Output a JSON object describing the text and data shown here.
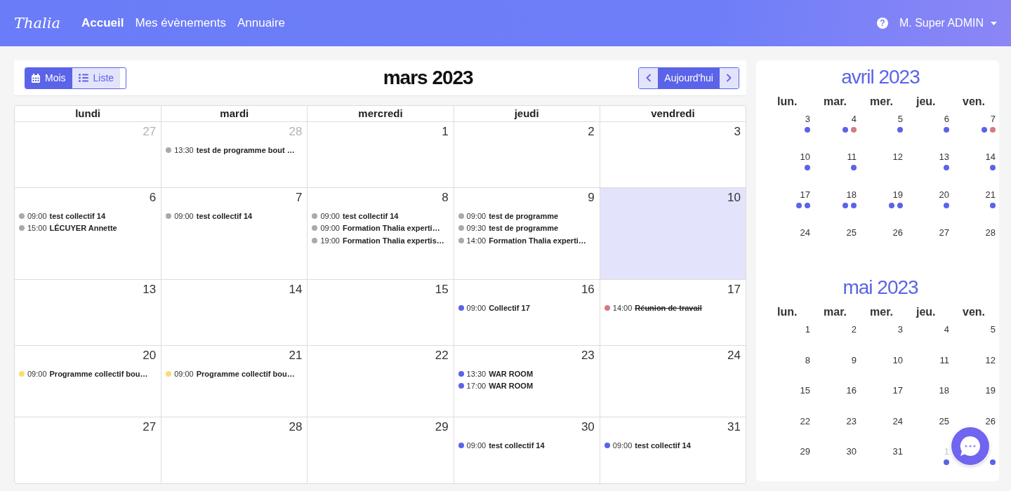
{
  "nav": {
    "logo": "Thalia",
    "links": [
      {
        "label": "Accueil",
        "selected": true
      },
      {
        "label": "Mes évènements",
        "selected": false
      },
      {
        "label": "Annuaire",
        "selected": false
      }
    ],
    "help": "?",
    "user": "M. Super ADMIN"
  },
  "calendar": {
    "views": [
      {
        "label": "Mois",
        "selected": true,
        "kind": "month"
      },
      {
        "label": "Liste",
        "selected": false,
        "kind": "list"
      }
    ],
    "title": "mars 2023",
    "today_button": "Aujourd'hui",
    "weekdays": [
      "lundi",
      "mardi",
      "mercredi",
      "jeudi",
      "vendredi"
    ],
    "weeks": [
      [
        {
          "day": "27",
          "other_month": true,
          "today": false
        },
        {
          "day": "28",
          "other_month": true,
          "today": false,
          "events": [
            {
              "time": "13:30",
              "title": "test de programme bout …",
              "color": "#aaaaaa",
              "cancelled": false
            }
          ]
        },
        {
          "day": "1",
          "today": false
        },
        {
          "day": "2",
          "today": false
        },
        {
          "day": "3",
          "today": false
        }
      ],
      [
        {
          "day": "6",
          "today": false,
          "events": [
            {
              "time": "09:00",
              "title": "test collectif 14",
              "color": "#aaaaaa",
              "cancelled": false
            },
            {
              "time": "15:00",
              "title": "LÉCUYER Annette",
              "color": "#aaaaaa",
              "cancelled": false
            }
          ]
        },
        {
          "day": "7",
          "today": false,
          "events": [
            {
              "time": "09:00",
              "title": "test collectif 14",
              "color": "#aaaaaa",
              "cancelled": false
            }
          ]
        },
        {
          "day": "8",
          "today": false,
          "events": [
            {
              "time": "09:00",
              "title": "test collectif 14",
              "color": "#aaaaaa",
              "cancelled": false
            },
            {
              "time": "09:00",
              "title": "Formation Thalia experti…",
              "color": "#aaaaaa",
              "cancelled": false
            },
            {
              "time": "19:00",
              "title": "Formation Thalia expertis…",
              "color": "#aaaaaa",
              "cancelled": false
            }
          ]
        },
        {
          "day": "9",
          "today": false,
          "events": [
            {
              "time": "09:00",
              "title": "test de programme",
              "color": "#aaaaaa",
              "cancelled": false
            },
            {
              "time": "09:30",
              "title": "test de programme",
              "color": "#aaaaaa",
              "cancelled": false
            },
            {
              "time": "14:00",
              "title": "Formation Thalia experti…",
              "color": "#aaaaaa",
              "cancelled": false
            }
          ]
        },
        {
          "day": "10",
          "today": true
        }
      ],
      [
        {
          "day": "13",
          "today": false
        },
        {
          "day": "14",
          "today": false
        },
        {
          "day": "15",
          "today": false
        },
        {
          "day": "16",
          "today": false,
          "events": [
            {
              "time": "09:00",
              "title": "Collectif 17",
              "color": "#5b63e8",
              "cancelled": false
            }
          ]
        },
        {
          "day": "17",
          "today": false,
          "events": [
            {
              "time": "14:00",
              "title": "Réunion de travail",
              "color": "#d37a84",
              "cancelled": true
            }
          ]
        }
      ],
      [
        {
          "day": "20",
          "today": false,
          "events": [
            {
              "time": "09:00",
              "title": "Programme collectif bou…",
              "color": "#ffd97a",
              "cancelled": false
            }
          ]
        },
        {
          "day": "21",
          "today": false,
          "events": [
            {
              "time": "09:00",
              "title": "Programme collectif bou…",
              "color": "#ffd97a",
              "cancelled": false
            }
          ]
        },
        {
          "day": "22",
          "today": false
        },
        {
          "day": "23",
          "today": false,
          "events": [
            {
              "time": "13:30",
              "title": "WAR ROOM",
              "color": "#5b63e8",
              "cancelled": false
            },
            {
              "time": "17:00",
              "title": "WAR ROOM",
              "color": "#5b63e8",
              "cancelled": false
            }
          ]
        },
        {
          "day": "24",
          "today": false
        }
      ],
      [
        {
          "day": "27",
          "today": false
        },
        {
          "day": "28",
          "today": false
        },
        {
          "day": "29",
          "today": false
        },
        {
          "day": "30",
          "today": false,
          "events": [
            {
              "time": "09:00",
              "title": "test collectif 14",
              "color": "#5b63e8",
              "cancelled": false
            }
          ]
        },
        {
          "day": "31",
          "today": false,
          "events": [
            {
              "time": "09:00",
              "title": "test collectif 14",
              "color": "#5b63e8",
              "cancelled": false
            }
          ]
        }
      ]
    ]
  },
  "mini_calendars": [
    {
      "title": "avril 2023",
      "weekdays": [
        "lun.",
        "mar.",
        "mer.",
        "jeu.",
        "ven."
      ],
      "weeks": [
        [
          {
            "day": "3",
            "dots": [
              {
                "color": "#5b63e8"
              }
            ]
          },
          {
            "day": "4",
            "dots": [
              {
                "color": "#5b63e8"
              },
              {
                "color": "#d37a84"
              }
            ]
          },
          {
            "day": "5",
            "dots": [
              {
                "color": "#5b63e8"
              }
            ]
          },
          {
            "day": "6",
            "dots": [
              {
                "color": "#5b63e8"
              }
            ]
          },
          {
            "day": "7",
            "dots": [
              {
                "color": "#5b63e8"
              },
              {
                "color": "#d37a84"
              }
            ]
          }
        ],
        [
          {
            "day": "10",
            "dots": [
              {
                "color": "#5b63e8"
              }
            ]
          },
          {
            "day": "11",
            "dots": [
              {
                "color": "#5b63e8"
              }
            ]
          },
          {
            "day": "12"
          },
          {
            "day": "13",
            "dots": [
              {
                "color": "#5b63e8"
              }
            ]
          },
          {
            "day": "14",
            "dots": [
              {
                "color": "#5b63e8"
              }
            ]
          }
        ],
        [
          {
            "day": "17",
            "dots": [
              {
                "color": "#5b63e8"
              },
              {
                "color": "#5b63e8"
              }
            ]
          },
          {
            "day": "18",
            "dots": [
              {
                "color": "#5b63e8"
              },
              {
                "color": "#5b63e8"
              }
            ]
          },
          {
            "day": "19",
            "dots": [
              {
                "color": "#5b63e8"
              },
              {
                "color": "#5b63e8"
              }
            ]
          },
          {
            "day": "20",
            "dots": [
              {
                "color": "#5b63e8"
              }
            ]
          },
          {
            "day": "21",
            "dots": [
              {
                "color": "#5b63e8"
              }
            ]
          }
        ],
        [
          {
            "day": "24"
          },
          {
            "day": "25"
          },
          {
            "day": "26"
          },
          {
            "day": "27"
          },
          {
            "day": "28"
          }
        ]
      ]
    },
    {
      "title": "mai 2023",
      "weekdays": [
        "lun.",
        "mar.",
        "mer.",
        "jeu.",
        "ven."
      ],
      "weeks": [
        [
          {
            "day": "1"
          },
          {
            "day": "2"
          },
          {
            "day": "3"
          },
          {
            "day": "4"
          },
          {
            "day": "5"
          }
        ],
        [
          {
            "day": "8"
          },
          {
            "day": "9"
          },
          {
            "day": "10"
          },
          {
            "day": "11"
          },
          {
            "day": "12"
          }
        ],
        [
          {
            "day": "15"
          },
          {
            "day": "16"
          },
          {
            "day": "17"
          },
          {
            "day": "18"
          },
          {
            "day": "19"
          }
        ],
        [
          {
            "day": "22"
          },
          {
            "day": "23"
          },
          {
            "day": "24"
          },
          {
            "day": "25"
          },
          {
            "day": "26"
          }
        ],
        [
          {
            "day": "29"
          },
          {
            "day": "30"
          },
          {
            "day": "31"
          },
          {
            "day": "1",
            "other_month": true,
            "dots": [
              {
                "color": "#5b63e8"
              }
            ]
          },
          {
            "dots": [
              {
                "color": "#5b63e8"
              }
            ]
          }
        ]
      ]
    }
  ]
}
